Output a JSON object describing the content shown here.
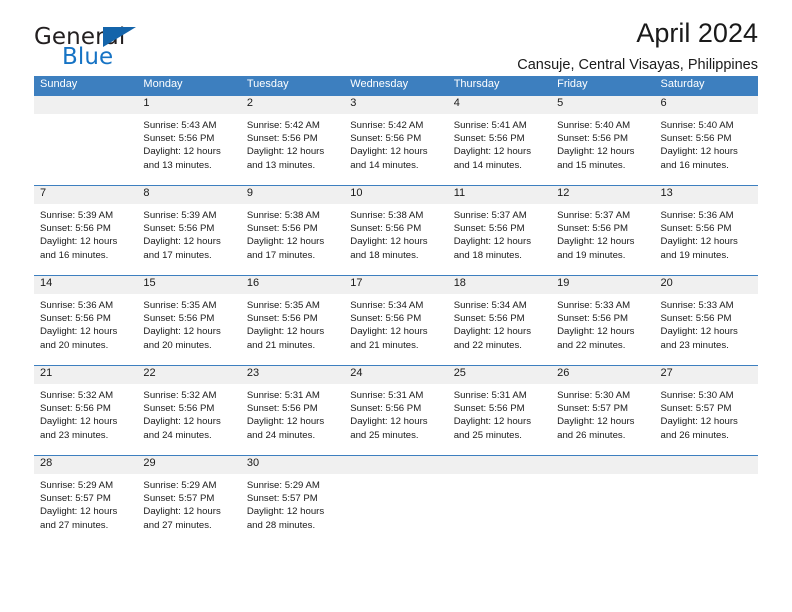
{
  "brand": {
    "name_part1": "General",
    "name_part2": "Blue",
    "triangle_color": "#1464aa",
    "blue_color": "#1673c4"
  },
  "header": {
    "title": "April 2024",
    "subtitle": "Cansuje, Central Visayas, Philippines"
  },
  "theme": {
    "header_blue": "#3d7fbf",
    "day_number_bg": "#f0f0f0",
    "text": "#1a1a1a"
  },
  "calendar": {
    "weekday_headers": [
      "Sunday",
      "Monday",
      "Tuesday",
      "Wednesday",
      "Thursday",
      "Friday",
      "Saturday"
    ],
    "weeks": [
      [
        {
          "day": "",
          "sunrise": "",
          "sunset": "",
          "daylight_line1": "",
          "daylight_line2": ""
        },
        {
          "day": "1",
          "sunrise": "Sunrise: 5:43 AM",
          "sunset": "Sunset: 5:56 PM",
          "daylight_line1": "Daylight: 12 hours",
          "daylight_line2": "and 13 minutes."
        },
        {
          "day": "2",
          "sunrise": "Sunrise: 5:42 AM",
          "sunset": "Sunset: 5:56 PM",
          "daylight_line1": "Daylight: 12 hours",
          "daylight_line2": "and 13 minutes."
        },
        {
          "day": "3",
          "sunrise": "Sunrise: 5:42 AM",
          "sunset": "Sunset: 5:56 PM",
          "daylight_line1": "Daylight: 12 hours",
          "daylight_line2": "and 14 minutes."
        },
        {
          "day": "4",
          "sunrise": "Sunrise: 5:41 AM",
          "sunset": "Sunset: 5:56 PM",
          "daylight_line1": "Daylight: 12 hours",
          "daylight_line2": "and 14 minutes."
        },
        {
          "day": "5",
          "sunrise": "Sunrise: 5:40 AM",
          "sunset": "Sunset: 5:56 PM",
          "daylight_line1": "Daylight: 12 hours",
          "daylight_line2": "and 15 minutes."
        },
        {
          "day": "6",
          "sunrise": "Sunrise: 5:40 AM",
          "sunset": "Sunset: 5:56 PM",
          "daylight_line1": "Daylight: 12 hours",
          "daylight_line2": "and 16 minutes."
        }
      ],
      [
        {
          "day": "7",
          "sunrise": "Sunrise: 5:39 AM",
          "sunset": "Sunset: 5:56 PM",
          "daylight_line1": "Daylight: 12 hours",
          "daylight_line2": "and 16 minutes."
        },
        {
          "day": "8",
          "sunrise": "Sunrise: 5:39 AM",
          "sunset": "Sunset: 5:56 PM",
          "daylight_line1": "Daylight: 12 hours",
          "daylight_line2": "and 17 minutes."
        },
        {
          "day": "9",
          "sunrise": "Sunrise: 5:38 AM",
          "sunset": "Sunset: 5:56 PM",
          "daylight_line1": "Daylight: 12 hours",
          "daylight_line2": "and 17 minutes."
        },
        {
          "day": "10",
          "sunrise": "Sunrise: 5:38 AM",
          "sunset": "Sunset: 5:56 PM",
          "daylight_line1": "Daylight: 12 hours",
          "daylight_line2": "and 18 minutes."
        },
        {
          "day": "11",
          "sunrise": "Sunrise: 5:37 AM",
          "sunset": "Sunset: 5:56 PM",
          "daylight_line1": "Daylight: 12 hours",
          "daylight_line2": "and 18 minutes."
        },
        {
          "day": "12",
          "sunrise": "Sunrise: 5:37 AM",
          "sunset": "Sunset: 5:56 PM",
          "daylight_line1": "Daylight: 12 hours",
          "daylight_line2": "and 19 minutes."
        },
        {
          "day": "13",
          "sunrise": "Sunrise: 5:36 AM",
          "sunset": "Sunset: 5:56 PM",
          "daylight_line1": "Daylight: 12 hours",
          "daylight_line2": "and 19 minutes."
        }
      ],
      [
        {
          "day": "14",
          "sunrise": "Sunrise: 5:36 AM",
          "sunset": "Sunset: 5:56 PM",
          "daylight_line1": "Daylight: 12 hours",
          "daylight_line2": "and 20 minutes."
        },
        {
          "day": "15",
          "sunrise": "Sunrise: 5:35 AM",
          "sunset": "Sunset: 5:56 PM",
          "daylight_line1": "Daylight: 12 hours",
          "daylight_line2": "and 20 minutes."
        },
        {
          "day": "16",
          "sunrise": "Sunrise: 5:35 AM",
          "sunset": "Sunset: 5:56 PM",
          "daylight_line1": "Daylight: 12 hours",
          "daylight_line2": "and 21 minutes."
        },
        {
          "day": "17",
          "sunrise": "Sunrise: 5:34 AM",
          "sunset": "Sunset: 5:56 PM",
          "daylight_line1": "Daylight: 12 hours",
          "daylight_line2": "and 21 minutes."
        },
        {
          "day": "18",
          "sunrise": "Sunrise: 5:34 AM",
          "sunset": "Sunset: 5:56 PM",
          "daylight_line1": "Daylight: 12 hours",
          "daylight_line2": "and 22 minutes."
        },
        {
          "day": "19",
          "sunrise": "Sunrise: 5:33 AM",
          "sunset": "Sunset: 5:56 PM",
          "daylight_line1": "Daylight: 12 hours",
          "daylight_line2": "and 22 minutes."
        },
        {
          "day": "20",
          "sunrise": "Sunrise: 5:33 AM",
          "sunset": "Sunset: 5:56 PM",
          "daylight_line1": "Daylight: 12 hours",
          "daylight_line2": "and 23 minutes."
        }
      ],
      [
        {
          "day": "21",
          "sunrise": "Sunrise: 5:32 AM",
          "sunset": "Sunset: 5:56 PM",
          "daylight_line1": "Daylight: 12 hours",
          "daylight_line2": "and 23 minutes."
        },
        {
          "day": "22",
          "sunrise": "Sunrise: 5:32 AM",
          "sunset": "Sunset: 5:56 PM",
          "daylight_line1": "Daylight: 12 hours",
          "daylight_line2": "and 24 minutes."
        },
        {
          "day": "23",
          "sunrise": "Sunrise: 5:31 AM",
          "sunset": "Sunset: 5:56 PM",
          "daylight_line1": "Daylight: 12 hours",
          "daylight_line2": "and 24 minutes."
        },
        {
          "day": "24",
          "sunrise": "Sunrise: 5:31 AM",
          "sunset": "Sunset: 5:56 PM",
          "daylight_line1": "Daylight: 12 hours",
          "daylight_line2": "and 25 minutes."
        },
        {
          "day": "25",
          "sunrise": "Sunrise: 5:31 AM",
          "sunset": "Sunset: 5:56 PM",
          "daylight_line1": "Daylight: 12 hours",
          "daylight_line2": "and 25 minutes."
        },
        {
          "day": "26",
          "sunrise": "Sunrise: 5:30 AM",
          "sunset": "Sunset: 5:57 PM",
          "daylight_line1": "Daylight: 12 hours",
          "daylight_line2": "and 26 minutes."
        },
        {
          "day": "27",
          "sunrise": "Sunrise: 5:30 AM",
          "sunset": "Sunset: 5:57 PM",
          "daylight_line1": "Daylight: 12 hours",
          "daylight_line2": "and 26 minutes."
        }
      ],
      [
        {
          "day": "28",
          "sunrise": "Sunrise: 5:29 AM",
          "sunset": "Sunset: 5:57 PM",
          "daylight_line1": "Daylight: 12 hours",
          "daylight_line2": "and 27 minutes."
        },
        {
          "day": "29",
          "sunrise": "Sunrise: 5:29 AM",
          "sunset": "Sunset: 5:57 PM",
          "daylight_line1": "Daylight: 12 hours",
          "daylight_line2": "and 27 minutes."
        },
        {
          "day": "30",
          "sunrise": "Sunrise: 5:29 AM",
          "sunset": "Sunset: 5:57 PM",
          "daylight_line1": "Daylight: 12 hours",
          "daylight_line2": "and 28 minutes."
        },
        {
          "day": "",
          "sunrise": "",
          "sunset": "",
          "daylight_line1": "",
          "daylight_line2": ""
        },
        {
          "day": "",
          "sunrise": "",
          "sunset": "",
          "daylight_line1": "",
          "daylight_line2": ""
        },
        {
          "day": "",
          "sunrise": "",
          "sunset": "",
          "daylight_line1": "",
          "daylight_line2": ""
        },
        {
          "day": "",
          "sunrise": "",
          "sunset": "",
          "daylight_line1": "",
          "daylight_line2": ""
        }
      ]
    ]
  }
}
